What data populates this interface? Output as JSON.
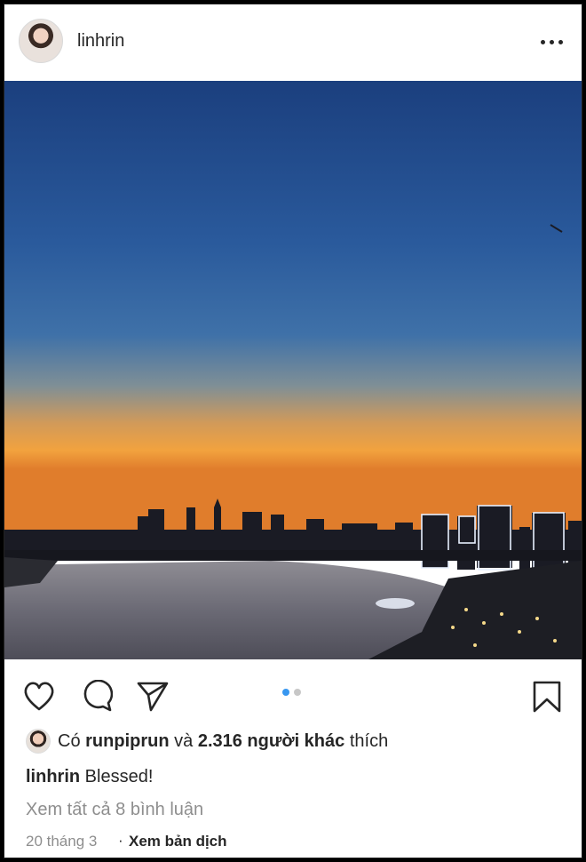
{
  "post": {
    "username": "linhrin",
    "more_icon": "more-horizontal-icon",
    "photo_alt": "sunset-city-skyline-river",
    "carousel": {
      "count": 2,
      "active": 0,
      "active_color": "#3897f0",
      "inactive_color": "#c7c7c7"
    },
    "actions": {
      "like_icon": "heart-icon",
      "comment_icon": "comment-icon",
      "share_icon": "send-icon",
      "save_icon": "bookmark-icon"
    },
    "likes": {
      "prefix": "Có",
      "user": "runpiprun",
      "middle": "và",
      "others": "2.316 người khác",
      "suffix": "thích"
    },
    "caption": {
      "user": "linhrin",
      "text": "Blessed!"
    },
    "view_comments": "Xem tất cả 8 bình luận",
    "date": "20 tháng 3",
    "separator": "·",
    "translate": "Xem bản dịch"
  }
}
